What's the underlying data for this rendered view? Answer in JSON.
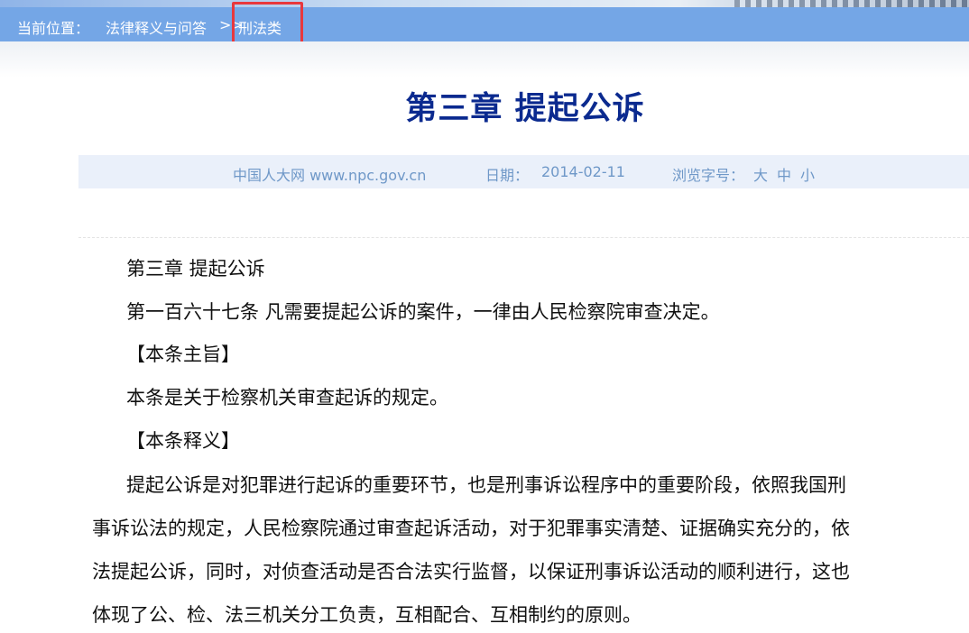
{
  "breadcrumb": {
    "label": "当前位置：",
    "link1": "法律释义与问答",
    "separator": ">>",
    "link2": "刑法类"
  },
  "article": {
    "title": "第三章 提起公诉"
  },
  "meta": {
    "source": "中国人大网 www.npc.gov.cn",
    "date_label": "日期：",
    "date_value": "2014-02-11",
    "font_size_label": "浏览字号：",
    "font_large": "大",
    "font_medium": "中",
    "font_small": "小"
  },
  "content": {
    "chapter": "第三章 提起公诉",
    "article_text": "第一百六十七条 凡需要提起公诉的案件，一律由人民检察院审查决定。",
    "gist_heading": "【本条主旨】",
    "gist_text": "本条是关于检察机关审查起诉的规定。",
    "explain_heading": "【本条释义】",
    "explain_lines": [
      "提起公诉是对犯罪进行起诉的重要环节，也是刑事诉讼程序中的重要阶段，依照我国刑",
      "事诉讼法的规定，人民检察院通过审查起诉活动，对于犯罪事实清楚、证据确实充分的，依",
      "法提起公诉，同时，对侦查活动是否合法实行监督，以保证刑事诉讼活动的顺利进行，这也",
      "体现了公、检、法三机关分工负责，互相配合、互相制约的原则。"
    ]
  },
  "colors": {
    "breadcrumb_bg": "#74a6e6",
    "title": "#0b2a8f",
    "meta_text": "#6f98c8",
    "highlight": "#e8383d"
  }
}
